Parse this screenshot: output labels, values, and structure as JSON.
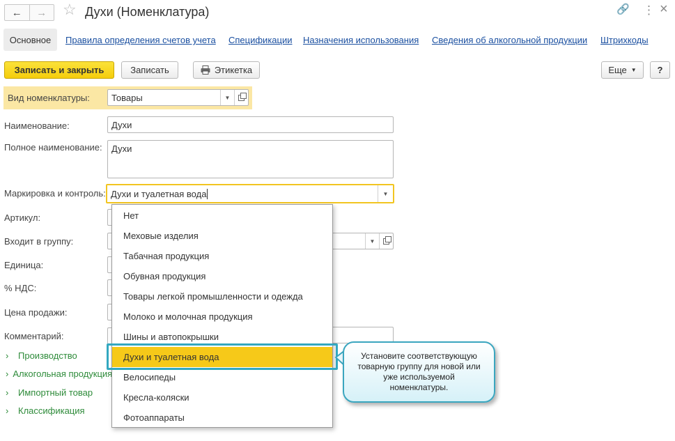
{
  "window": {
    "title": "Духи (Номенклатура)",
    "back_glyph": "←",
    "forward_glyph": "→",
    "star_glyph": "☆",
    "link_glyph": "🔗",
    "menu_glyph": "⋮",
    "close_glyph": "×"
  },
  "tabs": {
    "active": "Основное",
    "links": [
      "Правила определения счетов учета",
      "Спецификации",
      "Назначения использования",
      "Сведения об алкогольной продукции",
      "Штрихкоды"
    ]
  },
  "toolbar": {
    "save_close": "Записать и закрыть",
    "save": "Записать",
    "label_print": "Этикетка",
    "more": "Еще",
    "help": "?"
  },
  "form": {
    "kind_label": "Вид номенклатуры:",
    "kind_value": "Товары",
    "name_label": "Наименование:",
    "name_value": "Духи",
    "full_name_label": "Полное наименование:",
    "full_name_value": "Духи",
    "marking_label": "Маркировка и контроль:",
    "marking_value": "Духи и туалетная вода",
    "article_label": "Артикул:",
    "group_label": "Входит в группу:",
    "unit_label": "Единица:",
    "vat_label": "% НДС:",
    "price_label": "Цена продажи:",
    "comment_label": "Комментарий:"
  },
  "groups": [
    "Производство",
    "Алкогольная продукция",
    "Импортный товар",
    "Классификация"
  ],
  "dropdown": {
    "items": [
      "Нет",
      "Меховые изделия",
      "Табачная продукция",
      "Обувная продукция",
      "Товары легкой промышленности и одежда",
      "Молоко и молочная продукция",
      "Шины и автопокрышки",
      "Духи и туалетная вода",
      "Велосипеды",
      "Кресла-коляски",
      "Фотоаппараты"
    ],
    "selected": "Духи и туалетная вода"
  },
  "callout": {
    "text": "Установите соответствующую товарную группу для новой или уже используемой номенклатуры."
  },
  "colors": {
    "primary_button": "#f5cd0c",
    "highlight_row": "#fbe7a4",
    "selected_item": "#f6c919",
    "callout_border": "#3aa6bf",
    "link": "#1a4fa0",
    "group_link": "#2e8b3a"
  }
}
